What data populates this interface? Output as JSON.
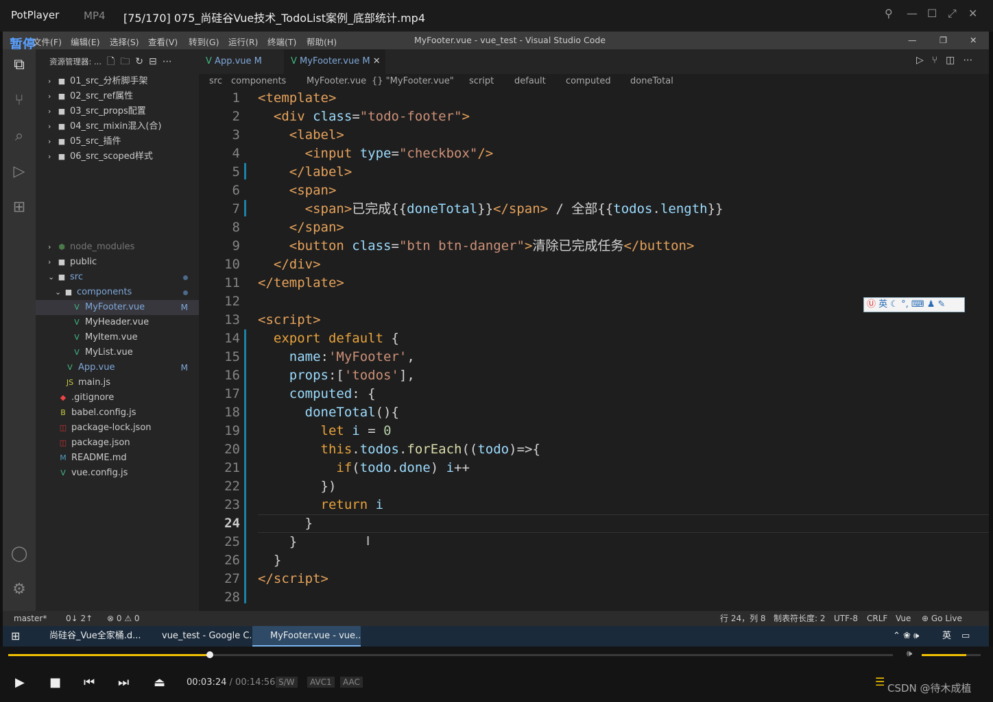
{
  "player": {
    "brand": "PotPlayer",
    "format": "MP4",
    "file_title": "[75/170] 075_尚硅谷Vue技术_TodoList案例_底部统计.mp4",
    "time_current": "00:03:24",
    "time_total": "/ 00:14:56",
    "chips": [
      "S/W",
      "AVC1",
      "AAC"
    ],
    "progress": 0.2277,
    "volume": 0.75,
    "watermark": "CSDN @待木成植",
    "paused_label": "暂停"
  },
  "vscode": {
    "menu": [
      "文件(F)",
      "编辑(E)",
      "选择(S)",
      "查看(V)",
      "转到(G)",
      "运行(R)",
      "终端(T)",
      "帮助(H)"
    ],
    "window_title": "MyFooter.vue - vue_test - Visual Studio Code",
    "explorer_header": "资源管理器: ...",
    "tree": [
      {
        "label": "01_src_分析脚手架",
        "type": "folder"
      },
      {
        "label": "02_src_ref属性",
        "type": "folder"
      },
      {
        "label": "03_src_props配置",
        "type": "folder"
      },
      {
        "label": "04_src_mixin混入(合)",
        "type": "folder"
      },
      {
        "label": "05_src_插件",
        "type": "folder"
      },
      {
        "label": "06_src_scoped样式",
        "type": "folder"
      }
    ],
    "tree2": [
      {
        "label": "node_modules"
      },
      {
        "label": "public"
      },
      {
        "label": "src"
      },
      {
        "label": "components"
      },
      {
        "label": "MyFooter.vue",
        "badge": "M"
      },
      {
        "label": "MyHeader.vue"
      },
      {
        "label": "MyItem.vue"
      },
      {
        "label": "MyList.vue"
      },
      {
        "label": "App.vue",
        "badge": "M"
      },
      {
        "label": "main.js"
      },
      {
        "label": ".gitignore"
      },
      {
        "label": "babel.config.js"
      },
      {
        "label": "package-lock.json"
      },
      {
        "label": "package.json"
      },
      {
        "label": "README.md"
      },
      {
        "label": "vue.config.js"
      }
    ],
    "tabs": [
      {
        "label": "App.vue",
        "badge": "M"
      },
      {
        "label": "MyFooter.vue",
        "badge": "M"
      }
    ],
    "breadcrumb": [
      "src",
      "components",
      "MyFooter.vue",
      "{} \"MyFooter.vue\"",
      "script",
      "default",
      "computed",
      "doneTotal"
    ],
    "status": {
      "branch": "master*",
      "sync": "0↓ 2↑",
      "problems": "0 ⚠ 0",
      "position": "行 24，列 8",
      "tabsize": "制表符长度: 2",
      "encoding": "UTF-8",
      "eol": "CRLF",
      "lang": "Vue",
      "golive": "Go Live"
    },
    "ime": "英"
  },
  "taskbar": {
    "items": [
      "尚硅谷_Vue全家桶.d...",
      "vue_test - Google C...",
      "MyFooter.vue - vue..."
    ],
    "tray_lang": "英"
  },
  "code_lines": [
    "1",
    "2",
    "3",
    "4",
    "5",
    "6",
    "7",
    "8",
    "9",
    "10",
    "11",
    "12",
    "13",
    "14",
    "15",
    "16",
    "17",
    "18",
    "19",
    "20",
    "21",
    "22",
    "23",
    "24",
    "25",
    "26",
    "27",
    "28"
  ]
}
